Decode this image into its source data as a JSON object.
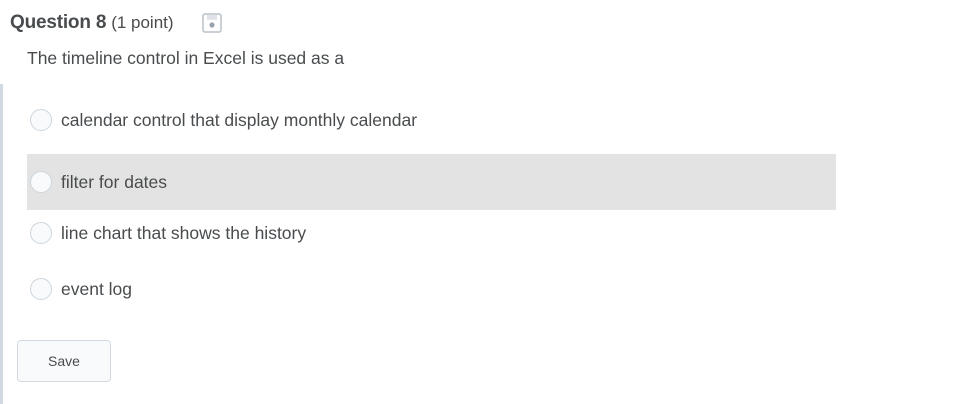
{
  "question": {
    "number_label": "Question 8",
    "points_label": "(1 point)",
    "save_status_icon": "floppy-disk-icon",
    "text": "The timeline control in Excel is used as a"
  },
  "options": [
    {
      "label": "calendar control that display monthly calendar",
      "selected": false
    },
    {
      "label": "filter for dates",
      "selected": false,
      "hovered": true
    },
    {
      "label": "line chart that shows the history",
      "selected": false
    },
    {
      "label": "event log",
      "selected": false
    }
  ],
  "actions": {
    "save_label": "Save"
  },
  "colors": {
    "text": "#494c4e",
    "hover_row": "#e3e3e3",
    "radio_border": "#cdd5dc",
    "button_border": "#d3d9e3"
  }
}
